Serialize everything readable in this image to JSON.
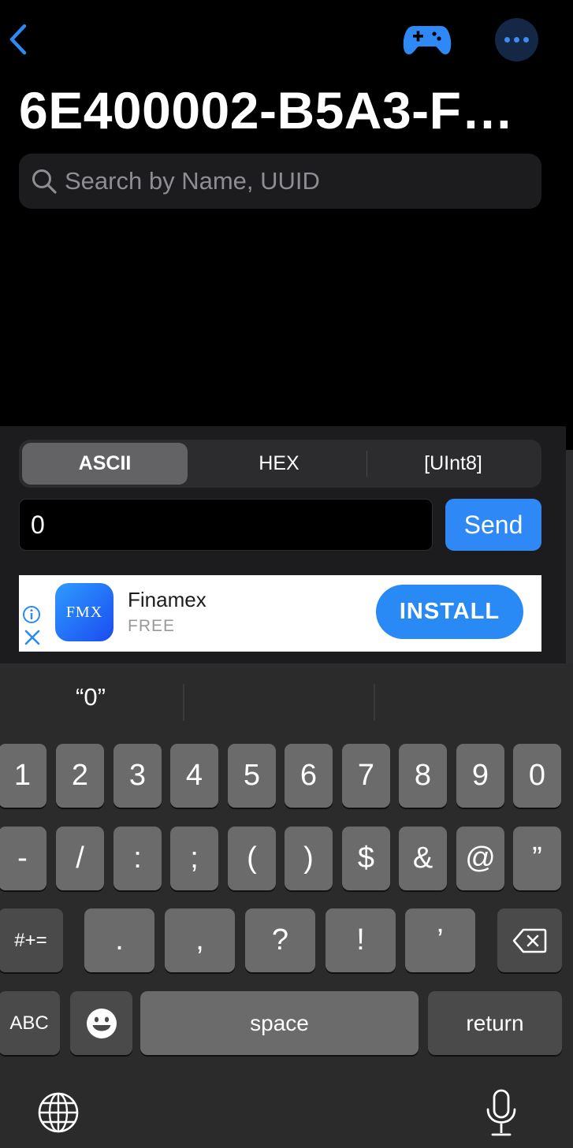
{
  "header": {
    "title": "6E400002-B5A3-F…",
    "back_icon": "chevron-left-icon",
    "gamepad_icon": "gamepad-icon",
    "more_icon": "ellipsis-icon",
    "accent": "#2e88f5"
  },
  "search": {
    "placeholder": "Search by Name, UUID",
    "value": ""
  },
  "format_tabs": {
    "items": [
      "ASCII",
      "HEX",
      "[UInt8]"
    ],
    "selected": "ASCII"
  },
  "write": {
    "value": "0",
    "send_label": "Send"
  },
  "ad": {
    "app_icon_text": "FMX",
    "app_name": "Finamex",
    "price": "FREE",
    "install_label": "INSTALL"
  },
  "keyboard": {
    "suggestions": [
      "“0”",
      "",
      ""
    ],
    "row1": [
      "1",
      "2",
      "3",
      "4",
      "5",
      "6",
      "7",
      "8",
      "9",
      "0"
    ],
    "row2": [
      "-",
      "/",
      ":",
      ";",
      "(",
      ")",
      "$",
      "&",
      "@",
      "”"
    ],
    "row3": {
      "shift_label": "#+=",
      "keys": [
        ".",
        ",",
        "?",
        "!",
        "’"
      ],
      "delete_icon": "backspace-icon"
    },
    "row4": {
      "abc_label": "ABC",
      "emoji_icon": "emoji-icon",
      "space_label": "space",
      "return_label": "return"
    },
    "globe_icon": "globe-icon",
    "mic_icon": "microphone-icon"
  }
}
